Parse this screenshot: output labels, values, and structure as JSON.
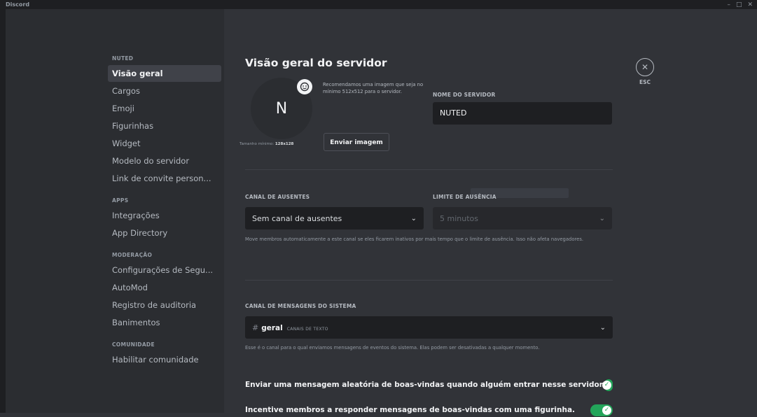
{
  "window": {
    "title": "Discord",
    "minimize": "–",
    "maximize": "□",
    "close": "✕"
  },
  "sidebar": {
    "server_header": "NUTED",
    "server_items": [
      "Visão geral",
      "Cargos",
      "Emoji",
      "Figurinhas",
      "Widget",
      "Modelo do servidor",
      "Link de convite person..."
    ],
    "apps_header": "APPS",
    "apps_items": [
      "Integrações",
      "App Directory"
    ],
    "moderation_header": "MODERAÇÃO",
    "moderation_items": [
      "Configurações de Segu...",
      "AutoMod",
      "Registro de auditoria",
      "Banimentos"
    ],
    "community_header": "COMUNIDADE",
    "community_items": [
      "Habilitar comunidade"
    ]
  },
  "main": {
    "title": "Visão geral do servidor",
    "avatar_letter": "N",
    "avatar_min_size_label": "Tamanho mínimo:",
    "avatar_min_size_value": "128x128",
    "recommendation": "Recomendamos uma imagem que seja no mínimo 512x512 para o servidor.",
    "upload_button": "Enviar imagem",
    "server_name_label": "NOME DO SERVIDOR",
    "server_name_value": "NUTED",
    "afk_channel_label": "CANAL DE AUSENTES",
    "afk_channel_value": "Sem canal de ausentes",
    "afk_limit_label": "LIMITE DE AUSÊNCIA",
    "afk_limit_value": "5 minutos",
    "afk_help": "Move membros automaticamente a este canal se eles ficarem inativos por mais tempo que o limite de ausência. Isso não afeta navegadores.",
    "system_channel_label": "CANAL DE MENSAGENS DO SISTEMA",
    "system_channel_hash": "#",
    "system_channel_name": "geral",
    "system_channel_type": "CANAIS DE TEXTO",
    "system_help": "Esse é o canal para o qual enviamos mensagens de eventos do sistema. Elas podem ser desativadas a qualquer momento.",
    "toggle_welcome": "Enviar uma mensagem aleatória de boas-vindas quando alguém entrar nesse servidor.",
    "toggle_sticker": "Incentive membros a responder mensagens de boas-vindas com uma figurinha.",
    "esc_label": "ESC"
  },
  "colors": {
    "accent_green": "#23a55a",
    "sidebar_bg": "#2b2d31",
    "content_bg": "#313338",
    "input_bg": "#1e1f22"
  },
  "icons": {
    "avatar_edit": "emoji-add-icon",
    "close": "close-circle-icon",
    "chevron": "chevron-down-icon",
    "check": "check-icon"
  }
}
